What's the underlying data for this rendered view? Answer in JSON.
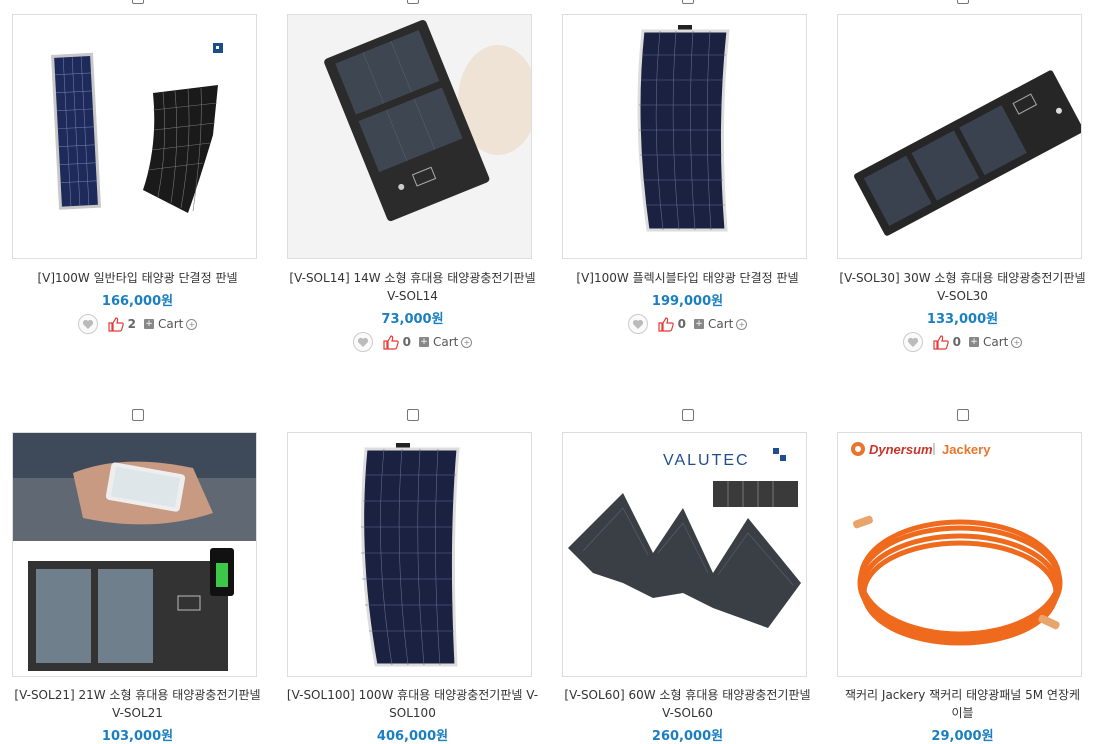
{
  "products": [
    {
      "name_line1": "[V]100W 일반타입 태양광 단결정 판넬",
      "name_line2": "",
      "price": "166,000원",
      "likes": "2",
      "cart": "Cart"
    },
    {
      "name_line1": "[V-SOL14] 14W 소형 휴대용 태양광충전기판넬",
      "name_line2": "V-SOL14",
      "price": "73,000원",
      "likes": "0",
      "cart": "Cart"
    },
    {
      "name_line1": "[V]100W 플렉시블타입 태양광 단결정 판넬",
      "name_line2": "",
      "price": "199,000원",
      "likes": "0",
      "cart": "Cart"
    },
    {
      "name_line1": "[V-SOL30] 30W 소형 휴대용 태양광충전기판넬",
      "name_line2": "V-SOL30",
      "price": "133,000원",
      "likes": "0",
      "cart": "Cart"
    },
    {
      "name_line1": "[V-SOL21] 21W 소형 휴대용 태양광충전기판넬",
      "name_line2": "V-SOL21",
      "price": "103,000원"
    },
    {
      "name_line1": "[V-SOL100] 100W 휴대용 태양광충전기판넬 V-",
      "name_line2": "SOL100",
      "price": "406,000원"
    },
    {
      "name_line1": "[V-SOL60] 60W 소형 휴대용 태양광충전기판넬",
      "name_line2": "V-SOL60",
      "price": "260,000원"
    },
    {
      "name_line1": "잭커리 Jackery 잭커리 태양광패널 5M 연장케",
      "name_line2": "이블",
      "price": "29,000원"
    }
  ],
  "brand_logos": {
    "valutec": "VALUTEC",
    "dynersum": "Dynersum",
    "jackery": "Jackery"
  },
  "colors": {
    "price": "#1a7fc1",
    "like_thumb": "#e53935"
  }
}
